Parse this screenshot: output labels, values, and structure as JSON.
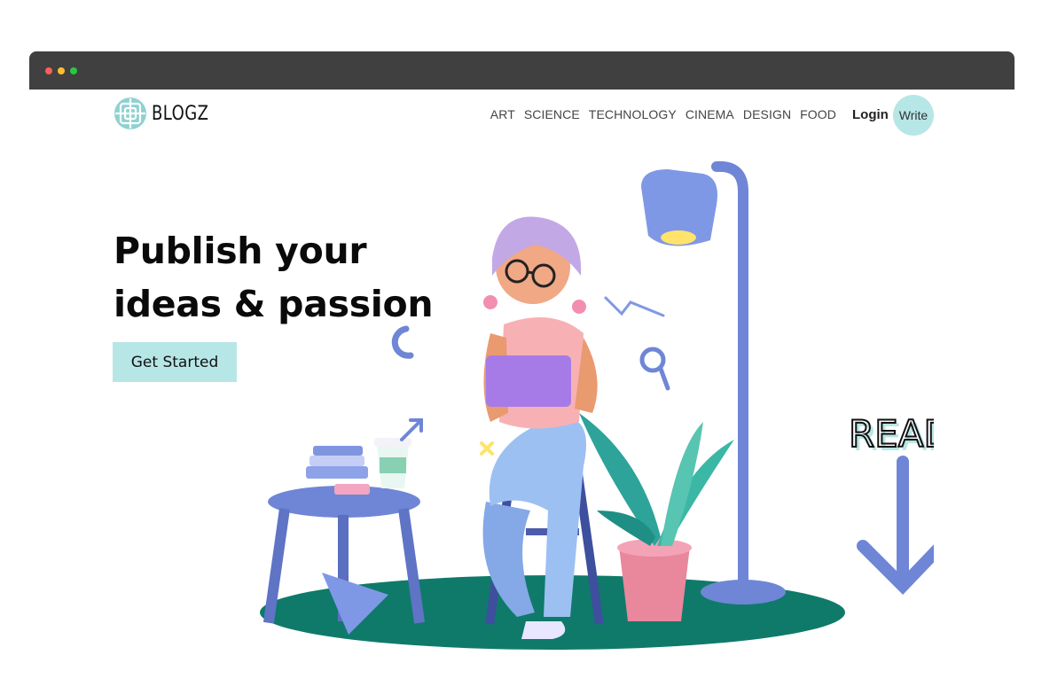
{
  "browser": {
    "controls": [
      "close",
      "minimize",
      "maximize"
    ],
    "colors": {
      "close": "#ff5f56",
      "minimize": "#ffbd2e",
      "maximize": "#27c93f"
    }
  },
  "header": {
    "logo_text": "BLOGZ",
    "logo_icon": "celtic-knot-icon",
    "nav": [
      "ART",
      "SCIENCE",
      "TECHNOLOGY",
      "CINEMA",
      "DESIGN",
      "FOOD"
    ],
    "login_label": "Login",
    "write_label": "Write"
  },
  "hero": {
    "title_line1": "Publish your",
    "title_line2": "ideas & passion",
    "cta_label": "Get Started",
    "illustration": {
      "description_icon": "reading-girl-illustration",
      "read_label": "READ"
    }
  },
  "theme": {
    "accent": "#b7e6e6",
    "ground": "#0f7a6a",
    "furniture": "#6f86d6"
  }
}
